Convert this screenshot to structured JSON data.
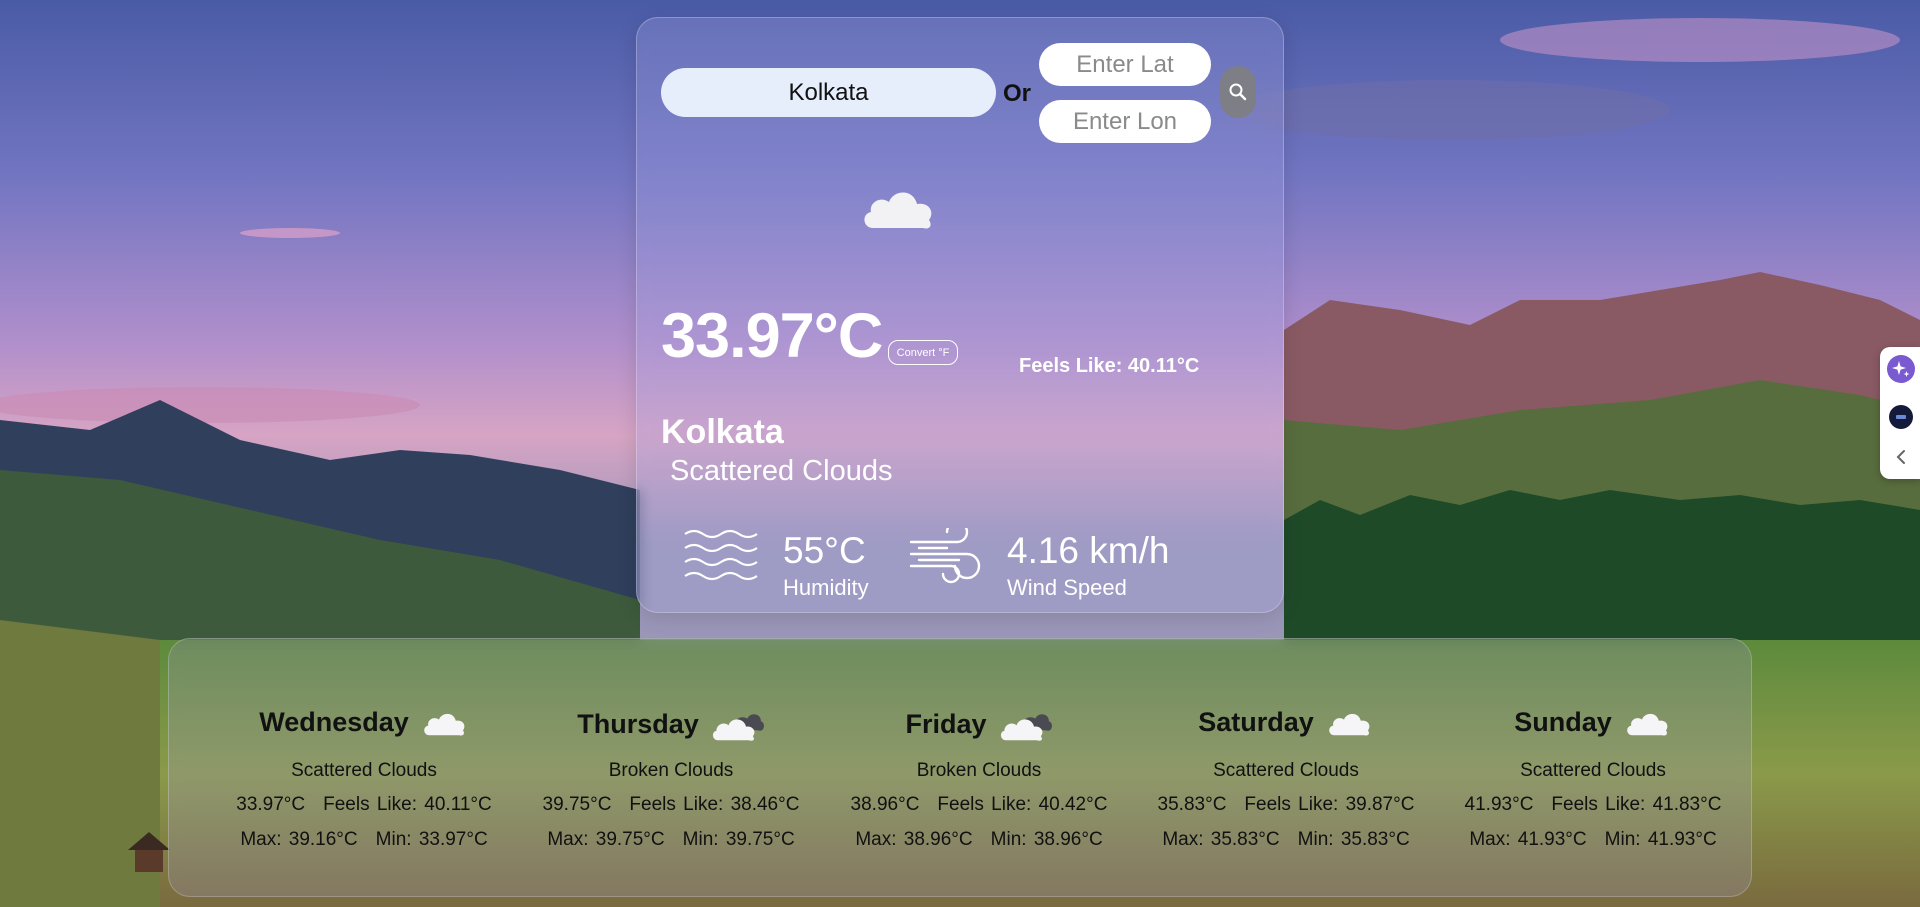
{
  "search": {
    "city_value": "Kolkata",
    "or_label": "Or",
    "lat_placeholder": "Enter Lat",
    "lon_placeholder": "Enter Lon"
  },
  "current": {
    "icon": "cloud-icon",
    "temperature": "33.97°C",
    "convert_label": "Convert °F",
    "feels_like": "Feels Like: 40.11°C",
    "city": "Kolkata",
    "condition": "Scattered Clouds",
    "humidity_value": "55°C",
    "humidity_label": "Humidity",
    "wind_value": "4.16 km/h",
    "wind_label": "Wind Speed"
  },
  "forecast": [
    {
      "day": "Wednesday",
      "icon": "cloud-icon",
      "condition": "Scattered Clouds",
      "temp": "33.97°C",
      "feels": "Feels Like: 40.11°C",
      "max": "Max: 39.16°C",
      "min": "Min: 33.97°C"
    },
    {
      "day": "Thursday",
      "icon": "broken-clouds-icon",
      "condition": "Broken Clouds",
      "temp": "39.75°C",
      "feels": "Feels Like: 38.46°C",
      "max": "Max: 39.75°C",
      "min": "Min: 39.75°C"
    },
    {
      "day": "Friday",
      "icon": "broken-clouds-icon",
      "condition": "Broken Clouds",
      "temp": "38.96°C",
      "feels": "Feels Like: 40.42°C",
      "max": "Max: 38.96°C",
      "min": "Min: 38.96°C"
    },
    {
      "day": "Saturday",
      "icon": "cloud-icon",
      "condition": "Scattered Clouds",
      "temp": "35.83°C",
      "feels": "Feels Like: 39.87°C",
      "max": "Max: 35.83°C",
      "min": "Min: 35.83°C"
    },
    {
      "day": "Sunday",
      "icon": "cloud-icon",
      "condition": "Scattered Clouds",
      "temp": "41.93°C",
      "feels": "Feels Like: 41.83°C",
      "max": "Max: 41.93°C",
      "min": "Min: 41.93°C"
    }
  ],
  "edge_tab": {
    "items": [
      "sparkle-icon",
      "extension-icon",
      "chevron-left-icon"
    ]
  },
  "colors": {
    "card_glass": "#aaaae6",
    "search_field": "#e6eefc",
    "search_button": "#7e7e86",
    "forecast_text": "#111111"
  }
}
